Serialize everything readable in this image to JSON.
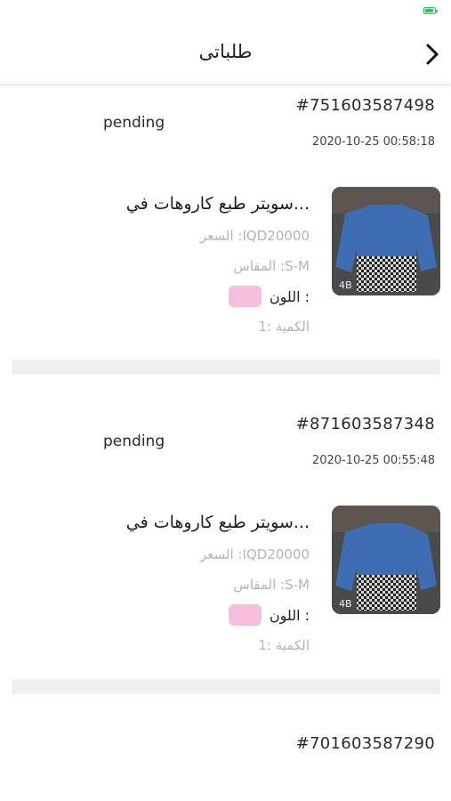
{
  "status_bar": {
    "battery_icon": "battery-icon"
  },
  "header": {
    "title": "طلباتی",
    "back_icon": "chevron-right-icon"
  },
  "colors": {
    "swatch": "#f6bddc",
    "battery": "#33c453"
  },
  "orders": [
    {
      "number": "#751603587498",
      "status": "pending",
      "date": "2020-10-25 00:58:18",
      "item": {
        "title": "سويتر طبع كاروهات في...",
        "price": "السعر :IQD20000",
        "size": "المقاس :S-M",
        "color_label": "اللون :",
        "quantity": "الكمية :1"
      }
    },
    {
      "number": "#871603587348",
      "status": "pending",
      "date": "2020-10-25 00:55:48",
      "item": {
        "title": "سويتر طبع كاروهات في...",
        "price": "السعر :IQD20000",
        "size": "المقاس :S-M",
        "color_label": "اللون :",
        "quantity": "الكمية :1"
      }
    },
    {
      "number": "#701603587290"
    }
  ]
}
